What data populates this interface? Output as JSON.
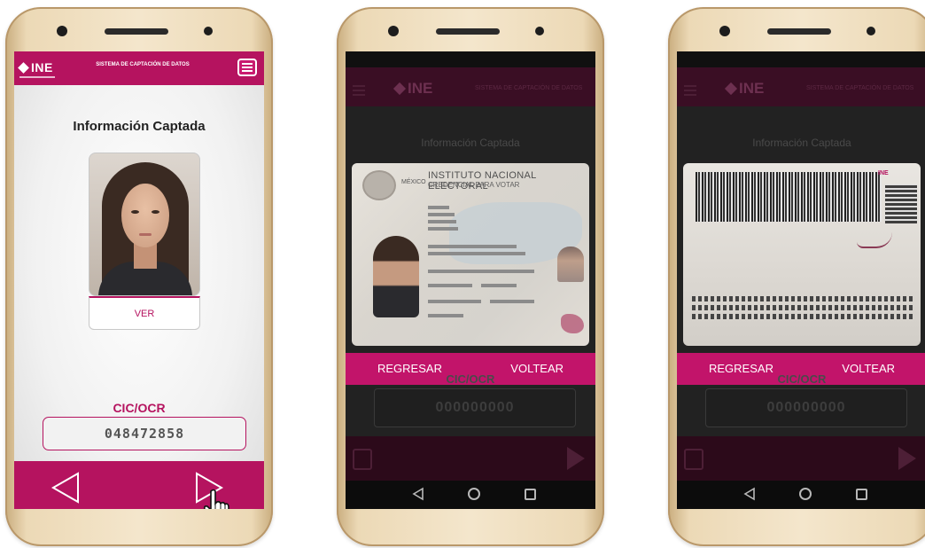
{
  "phone1": {
    "header": {
      "logo_text": "INE",
      "system_title": "SISTEMA DE CAPTACIÓN DE DATOS"
    },
    "title": "Información Captada",
    "photo_button_label": "VER",
    "cic_label": "CIC/OCR",
    "cic_value": "048472858"
  },
  "phone2": {
    "header": {
      "logo_text": "INE",
      "system_title": "SISTEMA DE CAPTACIÓN DE DATOS"
    },
    "title": "Información Captada",
    "card": {
      "country": "MÉXICO",
      "institute": "INSTITUTO NACIONAL ELECTORAL",
      "credential": "CREDENCIAL PARA VOTAR"
    },
    "actions": {
      "back_label": "REGRESAR",
      "flip_label": "VOLTEAR"
    },
    "folio_label": "CIC/OCR",
    "folio_value": "000000000"
  },
  "phone3": {
    "header": {
      "logo_text": "INE",
      "system_title": "SISTEMA DE CAPTACIÓN DE DATOS"
    },
    "title": "Información Captada",
    "card": {
      "brand": "INE"
    },
    "actions": {
      "back_label": "REGRESAR",
      "flip_label": "VOLTEAR"
    },
    "folio_label": "CIC/OCR",
    "folio_value": "000000000"
  },
  "colors": {
    "brand_magenta": "#b5135f",
    "action_magenta": "#c2146a"
  }
}
